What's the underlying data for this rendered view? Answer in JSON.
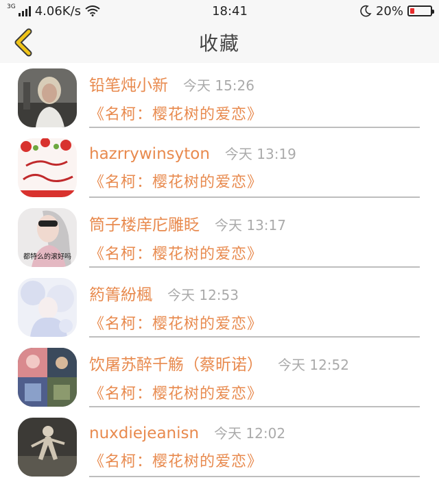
{
  "status_bar": {
    "network_type": "3G",
    "speed": "4.06K/s",
    "time": "18:41",
    "battery": "20%",
    "battery_level": 0.2,
    "icons": [
      "signal-icon",
      "wifi-icon",
      "moon-icon",
      "battery-icon"
    ]
  },
  "header": {
    "title": "收藏",
    "back_icon": "chevron-left-icon",
    "accent_color": "#f0c419"
  },
  "colors": {
    "name": "#e88a4e",
    "time": "#aaaaaa",
    "divider": "#bdbdbd"
  },
  "favorites": [
    {
      "name": "铅笔炖小新",
      "time": "今天 15:26",
      "title": "《名柯：樱花树的爱恋》"
    },
    {
      "name": "hazrrywinsyton",
      "time": "今天 13:19",
      "title": "《名柯：樱花树的爱恋》"
    },
    {
      "name": "筒子楼庠庀雕眨",
      "time": "今天 13:17",
      "title": "《名柯：樱花树的爱恋》",
      "avatar_text": "都特么的滚好吗"
    },
    {
      "name": "箹箐紛楓",
      "time": "今天 12:53",
      "title": "《名柯：樱花树的爱恋》"
    },
    {
      "name": "饮屠苏醉千觞（蔡昕诺）",
      "time": "今天 12:52",
      "title": "《名柯：樱花树的爱恋》"
    },
    {
      "name": "nuxdiejeanisn",
      "time": "今天 12:02",
      "title": "《名柯：樱花树的爱恋》"
    }
  ]
}
